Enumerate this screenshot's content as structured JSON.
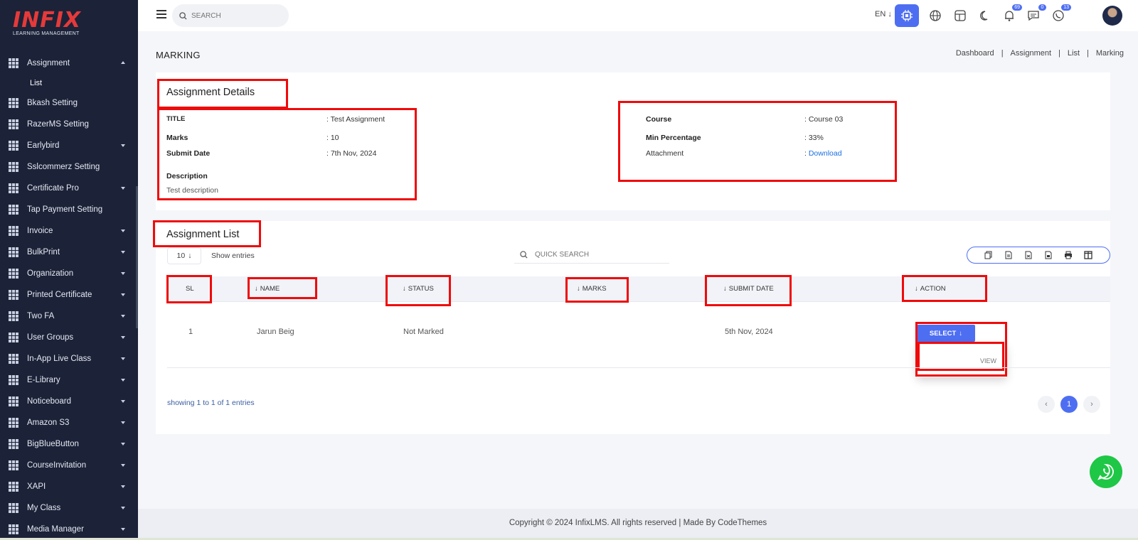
{
  "brand": {
    "name": "INFIX",
    "tagline": "LEARNING MANAGEMENT"
  },
  "sidebar": {
    "items": [
      {
        "label": "Assignment",
        "caret": "up",
        "icon": "grid-icon"
      },
      {
        "label": "Bkash Setting",
        "caret": "none",
        "icon": "grid-icon"
      },
      {
        "label": "RazerMS Setting",
        "caret": "none",
        "icon": "grid-icon"
      },
      {
        "label": "Earlybird",
        "caret": "down",
        "icon": "grid-icon"
      },
      {
        "label": "Sslcommerz Setting",
        "caret": "none",
        "icon": "grid-icon"
      },
      {
        "label": "Certificate Pro",
        "caret": "down",
        "icon": "grid-icon"
      },
      {
        "label": "Tap Payment Setting",
        "caret": "none",
        "icon": "grid-icon"
      },
      {
        "label": "Invoice",
        "caret": "down",
        "icon": "grid-icon"
      },
      {
        "label": "BulkPrint",
        "caret": "down",
        "icon": "grid-icon"
      },
      {
        "label": "Organization",
        "caret": "down",
        "icon": "grid-icon"
      },
      {
        "label": "Printed Certificate",
        "caret": "down",
        "icon": "grid-icon"
      },
      {
        "label": "Two FA",
        "caret": "down",
        "icon": "grid-icon"
      },
      {
        "label": "User Groups",
        "caret": "down",
        "icon": "grid-icon"
      },
      {
        "label": "In-App Live Class",
        "caret": "down",
        "icon": "grid-icon"
      },
      {
        "label": "E-Library",
        "caret": "down",
        "icon": "grid-icon"
      },
      {
        "label": "Noticeboard",
        "caret": "down",
        "icon": "grid-icon"
      },
      {
        "label": "Amazon S3",
        "caret": "down",
        "icon": "grid-icon"
      },
      {
        "label": "BigBlueButton",
        "caret": "down",
        "icon": "grid-icon"
      },
      {
        "label": "CourseInvitation",
        "caret": "down",
        "icon": "grid-icon"
      },
      {
        "label": "XAPI",
        "caret": "down",
        "icon": "grid-icon"
      },
      {
        "label": "My Class",
        "caret": "down",
        "icon": "grid-icon"
      },
      {
        "label": "Media Manager",
        "caret": "down",
        "icon": "grid-icon"
      }
    ],
    "submenu": {
      "label": "List"
    }
  },
  "topbar": {
    "search_placeholder": "SEARCH",
    "lang": "EN",
    "notifications_count": "69",
    "messages_count": "0",
    "whatsapp_count": "13",
    "accent": "#4e6ef2"
  },
  "page": {
    "title": "MARKING",
    "breadcrumb": [
      "Dashboard",
      "Assignment",
      "List",
      "Marking"
    ]
  },
  "details": {
    "heading": "Assignment Details",
    "title_label": "TITLE",
    "title_value": ": Test Assignment",
    "marks_label": "Marks",
    "marks_value": ": 10",
    "submit_label": "Submit Date",
    "submit_value": ": 7th Nov, 2024",
    "description_label": "Description",
    "description_value": "Test description",
    "course_label": "Course",
    "course_value": ": Course 03",
    "minpct_label": "Min Percentage",
    "minpct_value": ": 33%",
    "attachment_label": "Attachment",
    "attachment_prefix": ": ",
    "attachment_link": "Download"
  },
  "list": {
    "heading": "Assignment List",
    "entries_value": "10",
    "entries_label": "Show entries",
    "quick_search_placeholder": "QUICK SEARCH",
    "columns": [
      "SL",
      "NAME",
      "STATUS",
      "MARKS",
      "SUBMIT DATE",
      "ACTION"
    ],
    "rows": [
      {
        "sl": "1",
        "name": "Jarun Beig",
        "status": "Not Marked",
        "marks": "",
        "submit_date": "5th Nov, 2024"
      }
    ],
    "select_label": "SELECT",
    "view_label": "VIEW",
    "showing": "showing 1 to 1 of 1 entries",
    "current_page": "1"
  },
  "footer": {
    "text": "Copyright © 2024 InfixLMS. All rights reserved | Made By CodeThemes"
  }
}
